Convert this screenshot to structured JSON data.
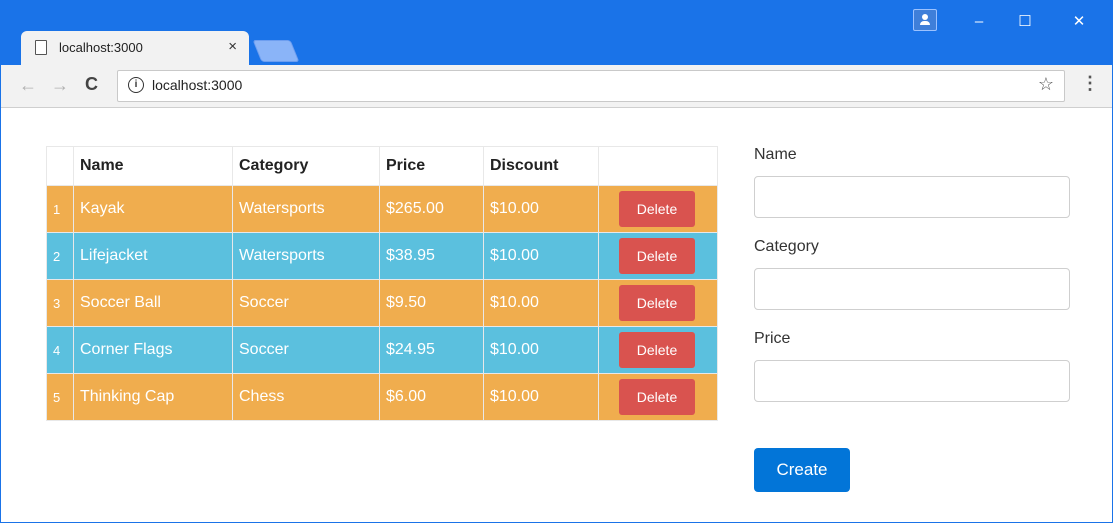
{
  "browser": {
    "tab_title": "localhost:3000",
    "tab_close": "×",
    "url": "localhost:3000",
    "window_controls": [
      "–",
      "☐",
      "✕"
    ]
  },
  "table": {
    "headers": [
      "",
      "Name",
      "Category",
      "Price",
      "Discount",
      ""
    ],
    "rows": [
      {
        "index": "1",
        "name": "Kayak",
        "category": "Watersports",
        "price": "$265.00",
        "discount": "$10.00",
        "action": "Delete",
        "color": "orange"
      },
      {
        "index": "2",
        "name": "Lifejacket",
        "category": "Watersports",
        "price": "$38.95",
        "discount": "$10.00",
        "action": "Delete",
        "color": "blue"
      },
      {
        "index": "3",
        "name": "Soccer Ball",
        "category": "Soccer",
        "price": "$9.50",
        "discount": "$10.00",
        "action": "Delete",
        "color": "orange"
      },
      {
        "index": "4",
        "name": "Corner Flags",
        "category": "Soccer",
        "price": "$24.95",
        "discount": "$10.00",
        "action": "Delete",
        "color": "blue"
      },
      {
        "index": "5",
        "name": "Thinking Cap",
        "category": "Chess",
        "price": "$6.00",
        "discount": "$10.00",
        "action": "Delete",
        "color": "orange"
      }
    ]
  },
  "form": {
    "name_label": "Name",
    "category_label": "Category",
    "price_label": "Price",
    "create_label": "Create"
  },
  "colors": {
    "titlebar": "#1a73e8",
    "row_orange": "#f0ad4e",
    "row_blue": "#5bc0de",
    "delete_button": "#d9534f",
    "create_button": "#0275d8"
  }
}
